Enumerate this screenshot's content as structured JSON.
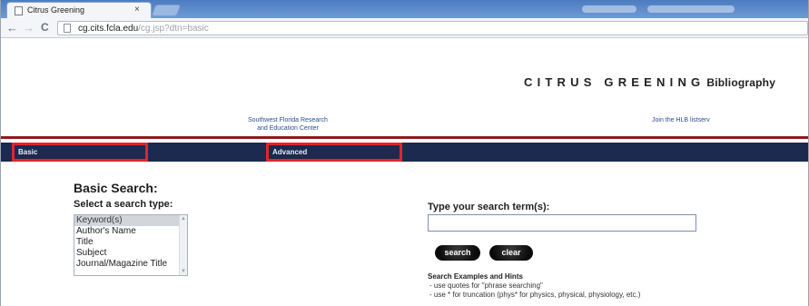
{
  "browser": {
    "tab_title": "Citrus Greening",
    "tab_close": "×",
    "back": "←",
    "forward": "→",
    "reload": "C",
    "url_host": "cg.cits.fcla.edu",
    "url_path": "/cg.jsp?dtn=basic"
  },
  "header": {
    "title_spaced": "CITRUS GREENING",
    "title_suffix": "Bibliography",
    "link_left_line1": "Southwest Florida Research",
    "link_left_line2": "and Education Center",
    "link_right": "Join the HLB listserv"
  },
  "nav": {
    "basic": "Basic",
    "advanced": "Advanced"
  },
  "search": {
    "section_title": "Basic Search:",
    "type_label": "Select a search type:",
    "types": [
      "Keyword(s)",
      "Author's Name",
      "Title",
      "Subject",
      "Journal/Magazine Title"
    ],
    "term_label": "Type your search term(s):",
    "term_value": "",
    "search_button": "search",
    "clear_button": "clear",
    "hints_title": "Search Examples and Hints",
    "hint_1": "- use quotes for \"phrase searching\"",
    "hint_2": "- use * for truncation (phys* for physics, physical, physiology, etc.)"
  },
  "colors": {
    "navbar": "#1c2a4f",
    "highlight_box": "#e0252c",
    "rule": "#8f1a1a",
    "link": "#2a4f8f"
  }
}
